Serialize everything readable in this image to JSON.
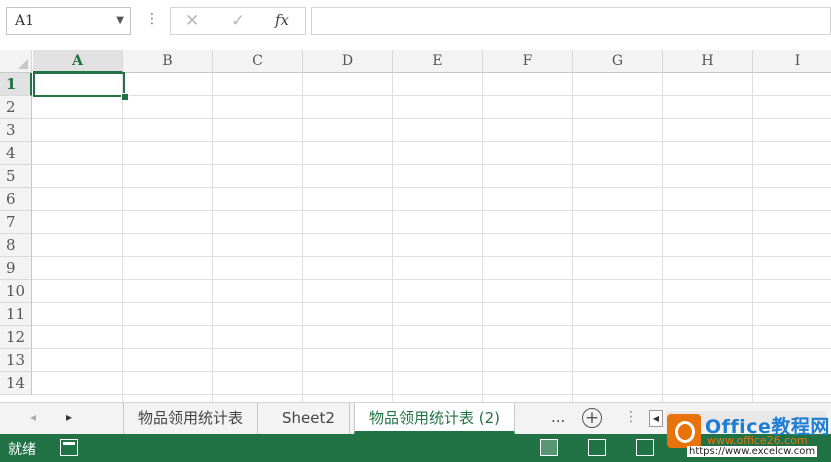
{
  "formula_bar": {
    "name_box": "A1",
    "dots": "⋮",
    "cancel": "✕",
    "enter": "✓",
    "fx": "fx",
    "content": ""
  },
  "grid": {
    "columns": [
      "A",
      "B",
      "C",
      "D",
      "E",
      "F",
      "G",
      "H",
      "I"
    ],
    "rows": [
      "1",
      "2",
      "3",
      "4",
      "5",
      "6",
      "7",
      "8",
      "9",
      "10",
      "11",
      "12",
      "13",
      "14"
    ],
    "active_cell": "A1"
  },
  "sheet_tabs": {
    "prev": "◂",
    "next": "▸",
    "tabs": [
      "物品领用统计表",
      "Sheet2",
      "物品领用统计表 (2)"
    ],
    "active_index": 2,
    "more": "...",
    "add": "+",
    "separator": "⋮",
    "scroll_left": "◀"
  },
  "status_bar": {
    "mode": "就绪"
  },
  "watermark": {
    "title": "Office教程网",
    "url1": "www.office26.com",
    "url2": "https://www.excelcw.com"
  },
  "colors": {
    "accent": "#217346",
    "watermark_orange": "#e8720c",
    "watermark_blue": "#1f7ed4"
  }
}
